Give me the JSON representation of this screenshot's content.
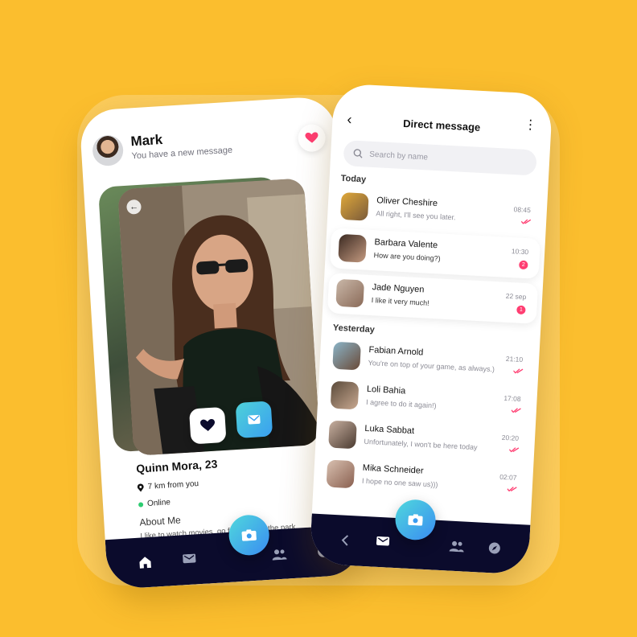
{
  "profile_screen": {
    "header": {
      "name": "Mark",
      "subtitle": "You have a new message"
    },
    "profile": {
      "name": "Quinn Mora, 23",
      "distance": "7 km from you",
      "status": "Online",
      "about_title": "About Me",
      "about_text": "I like to watch movies, go for walks in the park, take lots of pictures and eat ice cream 😍"
    },
    "nav": [
      "home-icon",
      "chat-icon",
      "people-icon",
      "compass-icon"
    ]
  },
  "dm_screen": {
    "title": "Direct message",
    "search_placeholder": "Search by name",
    "sections": {
      "today": "Today",
      "yesterday": "Yesterday"
    },
    "today": [
      {
        "name": "Oliver Cheshire",
        "text": "All right, I'll see you later.",
        "time": "08:45",
        "read": true
      },
      {
        "name": "Barbara Valente",
        "text": "How are you doing?)",
        "time": "10:30",
        "badge": "2"
      },
      {
        "name": "Jade Nguyen",
        "text": "I like it very much!",
        "time": "22 sep",
        "badge": "1"
      }
    ],
    "yesterday": [
      {
        "name": "Fabian Arnold",
        "text": "You're on top of your game, as always.)",
        "time": "21:10",
        "read": true
      },
      {
        "name": "Loli Bahia",
        "text": "I agree to do it again!)",
        "time": "17:08",
        "read": true
      },
      {
        "name": "Luka Sabbat",
        "text": "Unfortunately, I won't be here today",
        "time": "20:20",
        "read": true
      },
      {
        "name": "Mika Schneider",
        "text": "I hope no one saw us)))",
        "time": "02:07",
        "read": true
      }
    ],
    "nav": [
      "back-icon",
      "chat-icon",
      "people-icon",
      "compass-icon"
    ]
  },
  "colors": {
    "background": "#FBBE2E",
    "nav": "#0b0b2c",
    "accent": "#3a9cf0",
    "badge": "#ff3d71"
  }
}
